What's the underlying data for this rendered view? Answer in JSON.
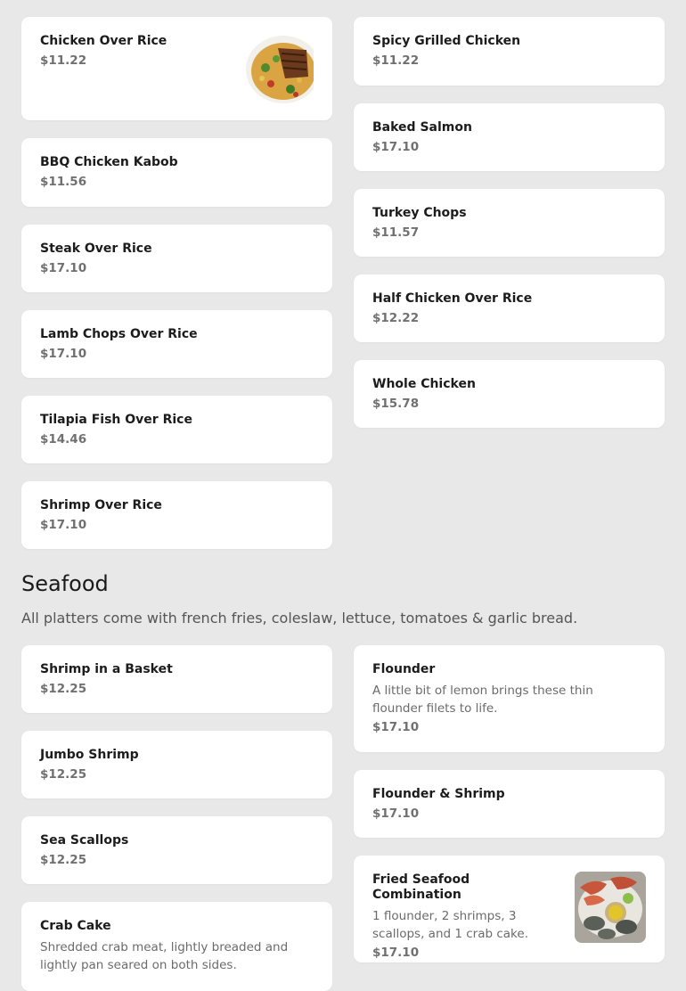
{
  "colors": {
    "page_bg": "#e8e8e8",
    "card_bg": "#ffffff",
    "price": "#707070",
    "desc": "#6b6b6b"
  },
  "items_left": [
    {
      "name": "Chicken Over Rice",
      "price": "$11.22"
    },
    {
      "name": "BBQ Chicken Kabob",
      "price": "$11.56"
    },
    {
      "name": "Steak Over Rice",
      "price": "$17.10"
    },
    {
      "name": "Lamb Chops Over Rice",
      "price": "$17.10"
    },
    {
      "name": "Tilapia Fish Over Rice",
      "price": "$14.46"
    },
    {
      "name": "Shrimp Over Rice",
      "price": "$17.10"
    }
  ],
  "items_right": [
    {
      "name": "Spicy Grilled Chicken",
      "price": "$11.22"
    },
    {
      "name": "Baked Salmon",
      "price": "$17.10"
    },
    {
      "name": "Turkey Chops",
      "price": "$11.57"
    },
    {
      "name": "Half Chicken Over Rice",
      "price": "$12.22"
    },
    {
      "name": "Whole Chicken",
      "price": "$15.78"
    }
  ],
  "seafood": {
    "title": "Seafood",
    "subtitle": "All platters come with french fries, coleslaw, lettuce, tomatoes & garlic bread.",
    "left": [
      {
        "name": "Shrimp in a Basket",
        "price": "$12.25"
      },
      {
        "name": "Jumbo Shrimp",
        "price": "$12.25"
      },
      {
        "name": "Sea Scallops",
        "price": "$12.25"
      },
      {
        "name": "Crab Cake",
        "description": "Shredded crab meat, lightly breaded and lightly pan seared on both sides."
      }
    ],
    "right": [
      {
        "name": "Flounder",
        "description": "A little bit of lemon brings these thin flounder filets to life.",
        "price": "$17.10"
      },
      {
        "name": "Flounder & Shrimp",
        "price": "$17.10"
      },
      {
        "name": "Fried Seafood Combination",
        "description": "1 flounder, 2 shrimps, 3 scallops, and 1 crab cake.",
        "price": "$17.10"
      }
    ]
  },
  "icons": {
    "chicken_rice_photo": "food-photo",
    "seafood_combo_photo": "food-photo"
  }
}
